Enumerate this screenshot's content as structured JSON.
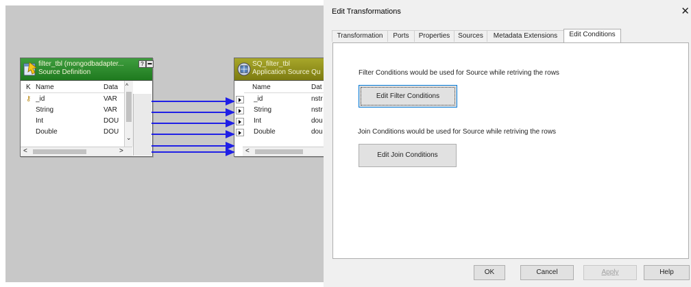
{
  "source_def": {
    "title": "filter_tbl (mongodbadapter...",
    "subtitle": "Source Definition",
    "col_key": "K",
    "col_name": "Name",
    "col_dtype": "Data",
    "rows": [
      {
        "name": "_id",
        "dtype": "VAR",
        "key": true
      },
      {
        "name": "String",
        "dtype": "VAR",
        "key": false
      },
      {
        "name": "Int",
        "dtype": "DOU",
        "key": false
      },
      {
        "name": "Double",
        "dtype": "DOU",
        "key": false
      }
    ],
    "help_glyph": "?",
    "min_glyph": "▬"
  },
  "source_qualifier": {
    "title": "SQ_filter_tbl",
    "subtitle": "Application Source Qu",
    "col_name": "Name",
    "col_dtype": "Dat",
    "rows": [
      {
        "name": "_id",
        "dtype": "nstr"
      },
      {
        "name": "String",
        "dtype": "nstr"
      },
      {
        "name": "Int",
        "dtype": "dou"
      },
      {
        "name": "Double",
        "dtype": "dou"
      }
    ]
  },
  "dialog": {
    "title": "Edit Transformations",
    "close_glyph": "✕",
    "tabs": [
      "Transformation",
      "Ports",
      "Properties",
      "Sources",
      "Metadata Extensions",
      "Edit Conditions"
    ],
    "active_tab": "Edit Conditions",
    "filter_text": "Filter Conditions would be used for Source while retriving the rows",
    "filter_button": "Edit Filter Conditions",
    "join_text": "Join Conditions would be used for Source while retriving the rows",
    "join_button": "Edit Join Conditions",
    "ok": "OK",
    "cancel": "Cancel",
    "apply": "Apply",
    "help": "Help"
  },
  "colors": {
    "canvas": "#c8c8c8",
    "source_header": "#2e8b2e",
    "sq_header": "#8f8e1a",
    "link": "#1f1fe6"
  }
}
